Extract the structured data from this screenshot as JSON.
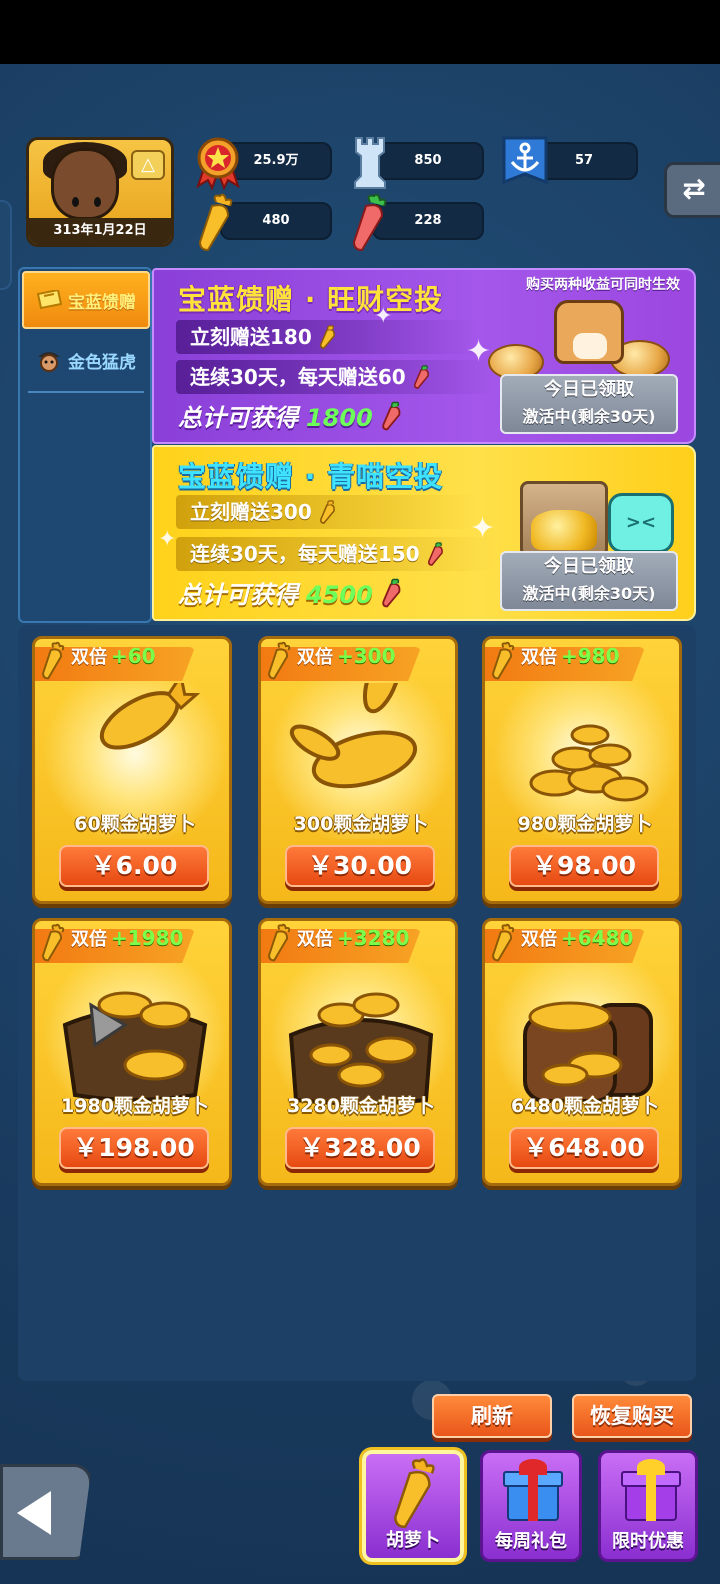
{
  "player": {
    "date": "313年1月22日"
  },
  "stats": {
    "power": "25.9万",
    "tower": "850",
    "anchor": "57",
    "gold_carrot": "480",
    "red_carrot": "228"
  },
  "side_menu": [
    {
      "label": "宝蓝馈赠"
    },
    {
      "label": "金色猛虎"
    }
  ],
  "promo_note": "购买两种收益可同时生效",
  "promos": [
    {
      "title": "宝蓝馈赠 · 旺财空投",
      "row1": "立刻赠送180",
      "row2": "连续30天，每天赠送60",
      "total_label": "总计可获得",
      "total_value": "1800",
      "claim_line1": "今日已领取",
      "claim_line2": "激活中(剩余30天)"
    },
    {
      "title": "宝蓝馈赠 · 青喵空投",
      "row1": "立刻赠送300",
      "row2": "连续30天，每天赠送150",
      "total_label": "总计可获得",
      "total_value": "4500",
      "claim_line1": "今日已领取",
      "claim_line2": "激活中(剩余30天)"
    }
  ],
  "shop": {
    "tag_label": "双倍",
    "items": [
      {
        "bonus": "+60",
        "name": "60颗金胡萝卜",
        "price": "￥6.00"
      },
      {
        "bonus": "+300",
        "name": "300颗金胡萝卜",
        "price": "￥30.00"
      },
      {
        "bonus": "+980",
        "name": "980颗金胡萝卜",
        "price": "￥98.00"
      },
      {
        "bonus": "+1980",
        "name": "1980颗金胡萝卜",
        "price": "￥198.00"
      },
      {
        "bonus": "+3280",
        "name": "3280颗金胡萝卜",
        "price": "￥328.00"
      },
      {
        "bonus": "+6480",
        "name": "6480颗金胡萝卜",
        "price": "￥648.00"
      }
    ]
  },
  "actions": {
    "refresh": "刷新",
    "restore": "恢复购买"
  },
  "tabs": [
    {
      "label": "胡萝卜"
    },
    {
      "label": "每周礼包"
    },
    {
      "label": "限时优惠"
    }
  ],
  "colors": {
    "background": "#1b3f63",
    "promo_purple": "#9b47e0",
    "promo_yellow": "#ffd21a",
    "price_button": "#e64a12",
    "bonus_green": "#7cff4a"
  }
}
